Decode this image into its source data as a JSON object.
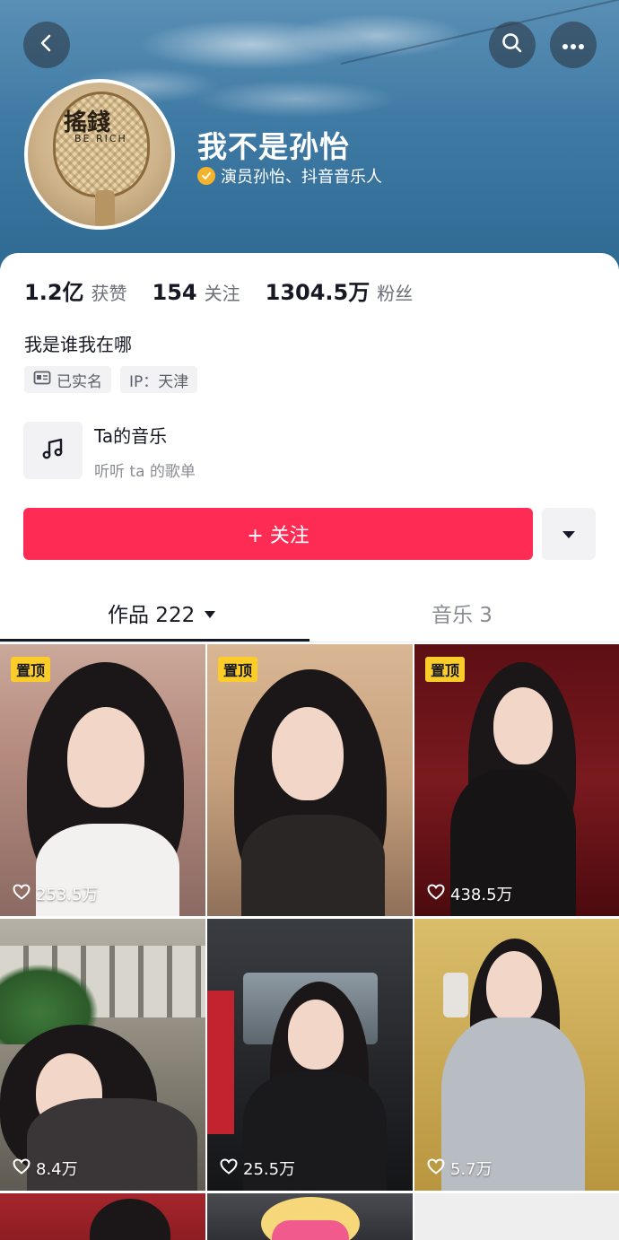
{
  "header": {
    "back_icon": "back-arrow-icon",
    "search_icon": "search-icon",
    "more_icon": "more-dots-icon",
    "avatar_text_main": "搖錢",
    "avatar_text_sub": "BE RICH"
  },
  "profile": {
    "name": "我不是孙怡",
    "verified_text": "演员孙怡、抖音音乐人",
    "verified_color": "#f5b22b"
  },
  "stats": [
    {
      "value": "1.2亿",
      "label": "获赞"
    },
    {
      "value": "154",
      "label": "关注"
    },
    {
      "value": "1304.5万",
      "label": "粉丝"
    }
  ],
  "bio": "我是谁我在哪",
  "tags": [
    {
      "icon": "id-card-icon",
      "text": "已实名"
    },
    {
      "text": "IP：天津"
    }
  ],
  "music": {
    "icon": "music-note-icon",
    "title": "Ta的音乐",
    "subtitle": "听听 ta 的歌单"
  },
  "actions": {
    "follow_label": "+ 关注",
    "follow_color": "#fe2c55",
    "dropdown_icon": "caret-down-icon"
  },
  "tabs": [
    {
      "label": "作品 222",
      "active": true
    },
    {
      "label": "音乐 3",
      "active": false
    }
  ],
  "videos": [
    {
      "pinned": true,
      "pin_label": "置顶",
      "likes": "253.5万"
    },
    {
      "pinned": true,
      "pin_label": "置顶",
      "likes": ""
    },
    {
      "pinned": true,
      "pin_label": "置顶",
      "likes": "438.5万"
    },
    {
      "pinned": false,
      "likes": "8.4万"
    },
    {
      "pinned": false,
      "likes": "25.5万"
    },
    {
      "pinned": false,
      "likes": "5.7万"
    }
  ]
}
